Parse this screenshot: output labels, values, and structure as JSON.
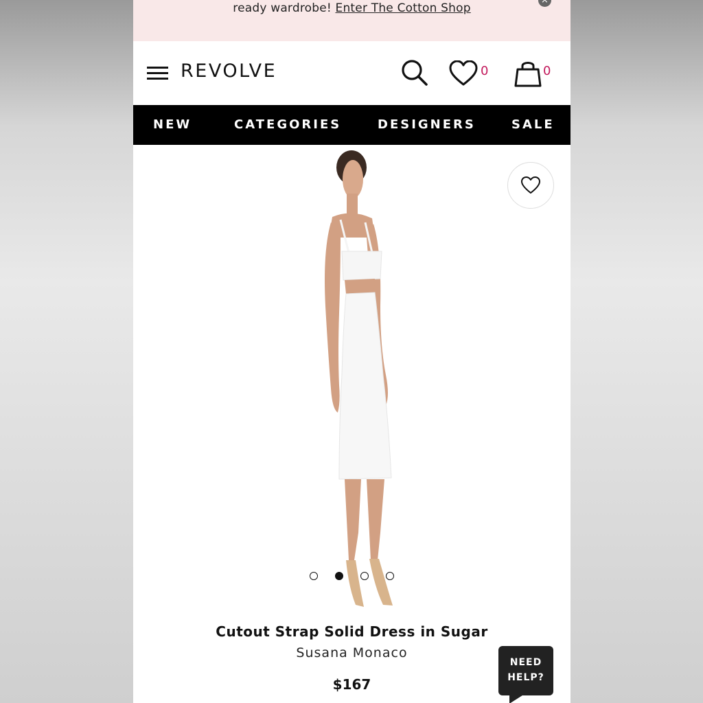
{
  "promo": {
    "text": "ready wardrobe!",
    "link": "Enter The Cotton Shop",
    "close": "×"
  },
  "header": {
    "logo": "REVOLVE",
    "wishlist_count": "0",
    "bag_count": "0"
  },
  "nav": {
    "items": [
      "NEW",
      "CATEGORIES",
      "DESIGNERS",
      "SALE"
    ]
  },
  "product": {
    "title": "Cutout Strap Solid Dress in Sugar",
    "brand": "Susana Monaco",
    "price": "$167",
    "image_count": 4,
    "active_image": 2
  },
  "help": {
    "line1": "NEED",
    "line2": "HELP?"
  },
  "colors": {
    "promo_bg": "#f9e8e8",
    "nav_bg": "#000000",
    "count_accent": "#c2185b"
  }
}
